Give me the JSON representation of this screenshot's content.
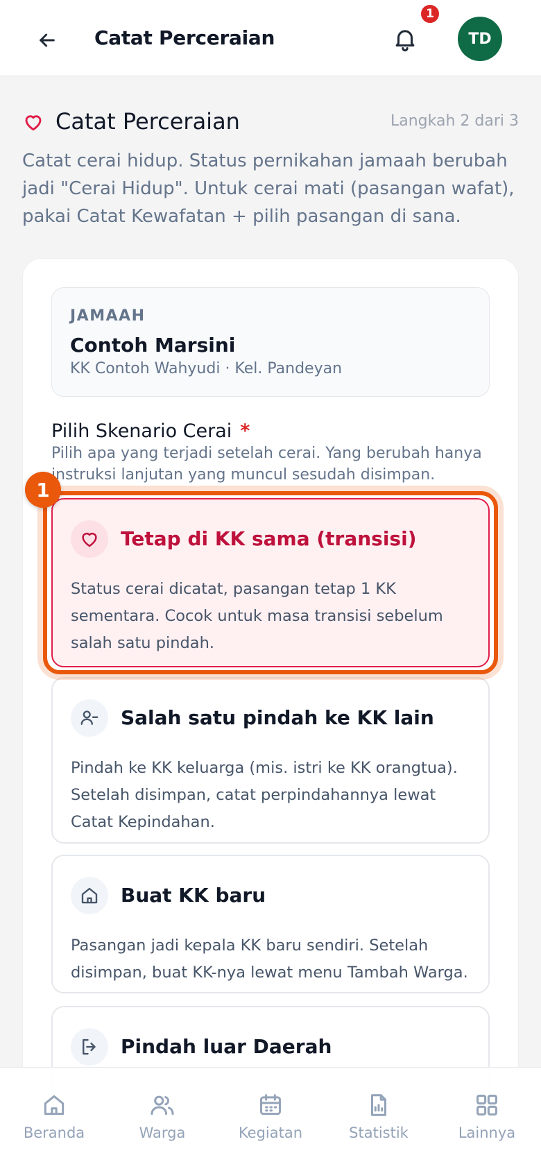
{
  "header": {
    "title": "Catat Perceraian",
    "notification_count": "1",
    "avatar_initials": "TD"
  },
  "section": {
    "title": "Catat Perceraian",
    "step": "Langkah 2 dari 3",
    "description": "Catat cerai hidup. Status pernikahan jamaah berubah jadi \"Cerai Hidup\". Untuk cerai mati (pasangan wafat), pakai Catat Kewafatan + pilih pasangan di sana."
  },
  "jamaah": {
    "label": "JAMAAH",
    "name": "Contoh Marsini",
    "meta": "KK Contoh Wahyudi · Kel. Pandeyan"
  },
  "scenario": {
    "label": "Pilih Skenario Cerai",
    "required_mark": "*",
    "hint": "Pilih apa yang terjadi setelah cerai. Yang berubah hanya instruksi lanjutan yang muncul sesudah disimpan.",
    "step_marker": "1",
    "options": [
      {
        "title": "Tetap di KK sama (transisi)",
        "description": "Status cerai dicatat, pasangan tetap 1 KK sementara. Cocok untuk masa transisi sebelum salah satu pindah.",
        "icon": "heart-icon",
        "selected": true
      },
      {
        "title": "Salah satu pindah ke KK lain",
        "description": "Pindah ke KK keluarga (mis. istri ke KK orangtua). Setelah disimpan, catat perpindahannya lewat Catat Kepindahan.",
        "icon": "user-minus-icon",
        "selected": false
      },
      {
        "title": "Buat KK baru",
        "description": "Pasangan jadi kepala KK baru sendiri. Setelah disimpan, buat KK-nya lewat menu Tambah Warga.",
        "icon": "home-icon",
        "selected": false
      },
      {
        "title": "Pindah luar Daerah",
        "description": "",
        "icon": "logout-icon",
        "selected": false
      }
    ]
  },
  "bottom_nav": [
    {
      "label": "Beranda",
      "icon": "home-icon"
    },
    {
      "label": "Warga",
      "icon": "users-icon"
    },
    {
      "label": "Kegiatan",
      "icon": "calendar-icon"
    },
    {
      "label": "Statistik",
      "icon": "chart-file-icon"
    },
    {
      "label": "Lainnya",
      "icon": "grid-icon"
    }
  ],
  "colors": {
    "accent": "#e11d48",
    "highlight": "#ea580c",
    "avatar_bg": "#0f6b45",
    "badge": "#dc2626"
  }
}
